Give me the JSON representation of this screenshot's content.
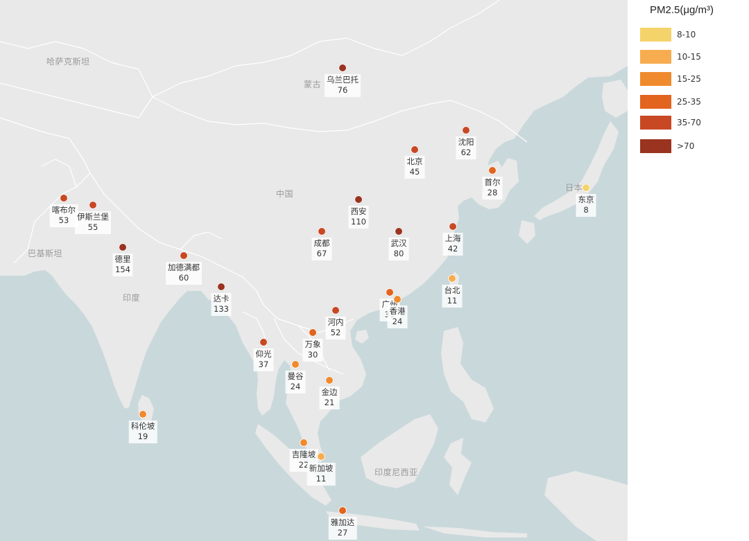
{
  "legend": {
    "title": "PM2.5(μg/m³)",
    "items": [
      {
        "label": "8-10",
        "color": "#f5d36b"
      },
      {
        "label": "10-15",
        "color": "#f7ad4f"
      },
      {
        "label": "15-25",
        "color": "#f08a2e"
      },
      {
        "label": "25-35",
        "color": "#e2641e"
      },
      {
        "label": "35-70",
        "color": "#c84824"
      },
      {
        "label": ">70",
        "color": "#9a3320"
      }
    ]
  },
  "map": {
    "colors": {
      "land": "#e9e9e9",
      "water": "#c9d8db",
      "border": "#ffffff"
    },
    "country_labels": [
      "哈萨克斯坦",
      "蒙古",
      "中国",
      "巴基斯坦",
      "印度",
      "日本",
      "印度尼西亚"
    ],
    "cities": [
      {
        "name": "乌兰巴托",
        "value": "76",
        "color": "#9a3320"
      },
      {
        "name": "沈阳",
        "value": "62",
        "color": "#c84824"
      },
      {
        "name": "北京",
        "value": "45",
        "color": "#c84824"
      },
      {
        "name": "首尔",
        "value": "28",
        "color": "#e2641e"
      },
      {
        "name": "东京",
        "value": "8",
        "color": "#f5d36b"
      },
      {
        "name": "喀布尔",
        "value": "53",
        "color": "#c84824"
      },
      {
        "name": "伊斯兰堡",
        "value": "55",
        "color": "#c84824"
      },
      {
        "name": "西安",
        "value": "110",
        "color": "#9a3320"
      },
      {
        "name": "成都",
        "value": "67",
        "color": "#c84824"
      },
      {
        "name": "武汉",
        "value": "80",
        "color": "#9a3320"
      },
      {
        "name": "上海",
        "value": "42",
        "color": "#c84824"
      },
      {
        "name": "德里",
        "value": "154",
        "color": "#9a3320"
      },
      {
        "name": "加德满都",
        "value": "60",
        "color": "#c84824"
      },
      {
        "name": "达卡",
        "value": "133",
        "color": "#9a3320"
      },
      {
        "name": "台北",
        "value": "11",
        "color": "#f7ad4f"
      },
      {
        "name": "广州",
        "value": "31",
        "color": "#e2641e"
      },
      {
        "name": "香港",
        "value": "24",
        "color": "#f08a2e"
      },
      {
        "name": "河内",
        "value": "52",
        "color": "#c84824"
      },
      {
        "name": "万象",
        "value": "30",
        "color": "#e2641e"
      },
      {
        "name": "仰光",
        "value": "37",
        "color": "#c84824"
      },
      {
        "name": "曼谷",
        "value": "24",
        "color": "#f08a2e"
      },
      {
        "name": "金边",
        "value": "21",
        "color": "#f08a2e"
      },
      {
        "name": "科伦坡",
        "value": "19",
        "color": "#f08a2e"
      },
      {
        "name": "吉隆坡",
        "value": "22",
        "color": "#f08a2e"
      },
      {
        "name": "新加坡",
        "value": "11",
        "color": "#f7ad4f"
      },
      {
        "name": "雅加达",
        "value": "27",
        "color": "#e2641e"
      }
    ]
  }
}
